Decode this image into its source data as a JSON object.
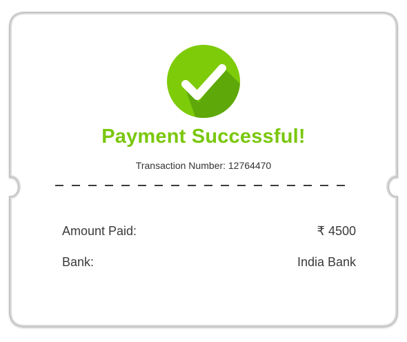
{
  "receipt": {
    "title": "Payment Successful!",
    "transaction": "Transaction Number: 12764470",
    "amount_label": "Amount Paid:",
    "amount_value": "₹ 4500",
    "bank_label": "Bank:",
    "bank_value": "India Bank"
  },
  "icons": {
    "status": "check-circle-icon"
  },
  "colors": {
    "success_green": "#7ac70c",
    "check_circle_main": "#7ecb09",
    "check_circle_shadow": "#5ea80a",
    "ticket_border": "#c8c8c8",
    "text": "#3a3a3a"
  }
}
